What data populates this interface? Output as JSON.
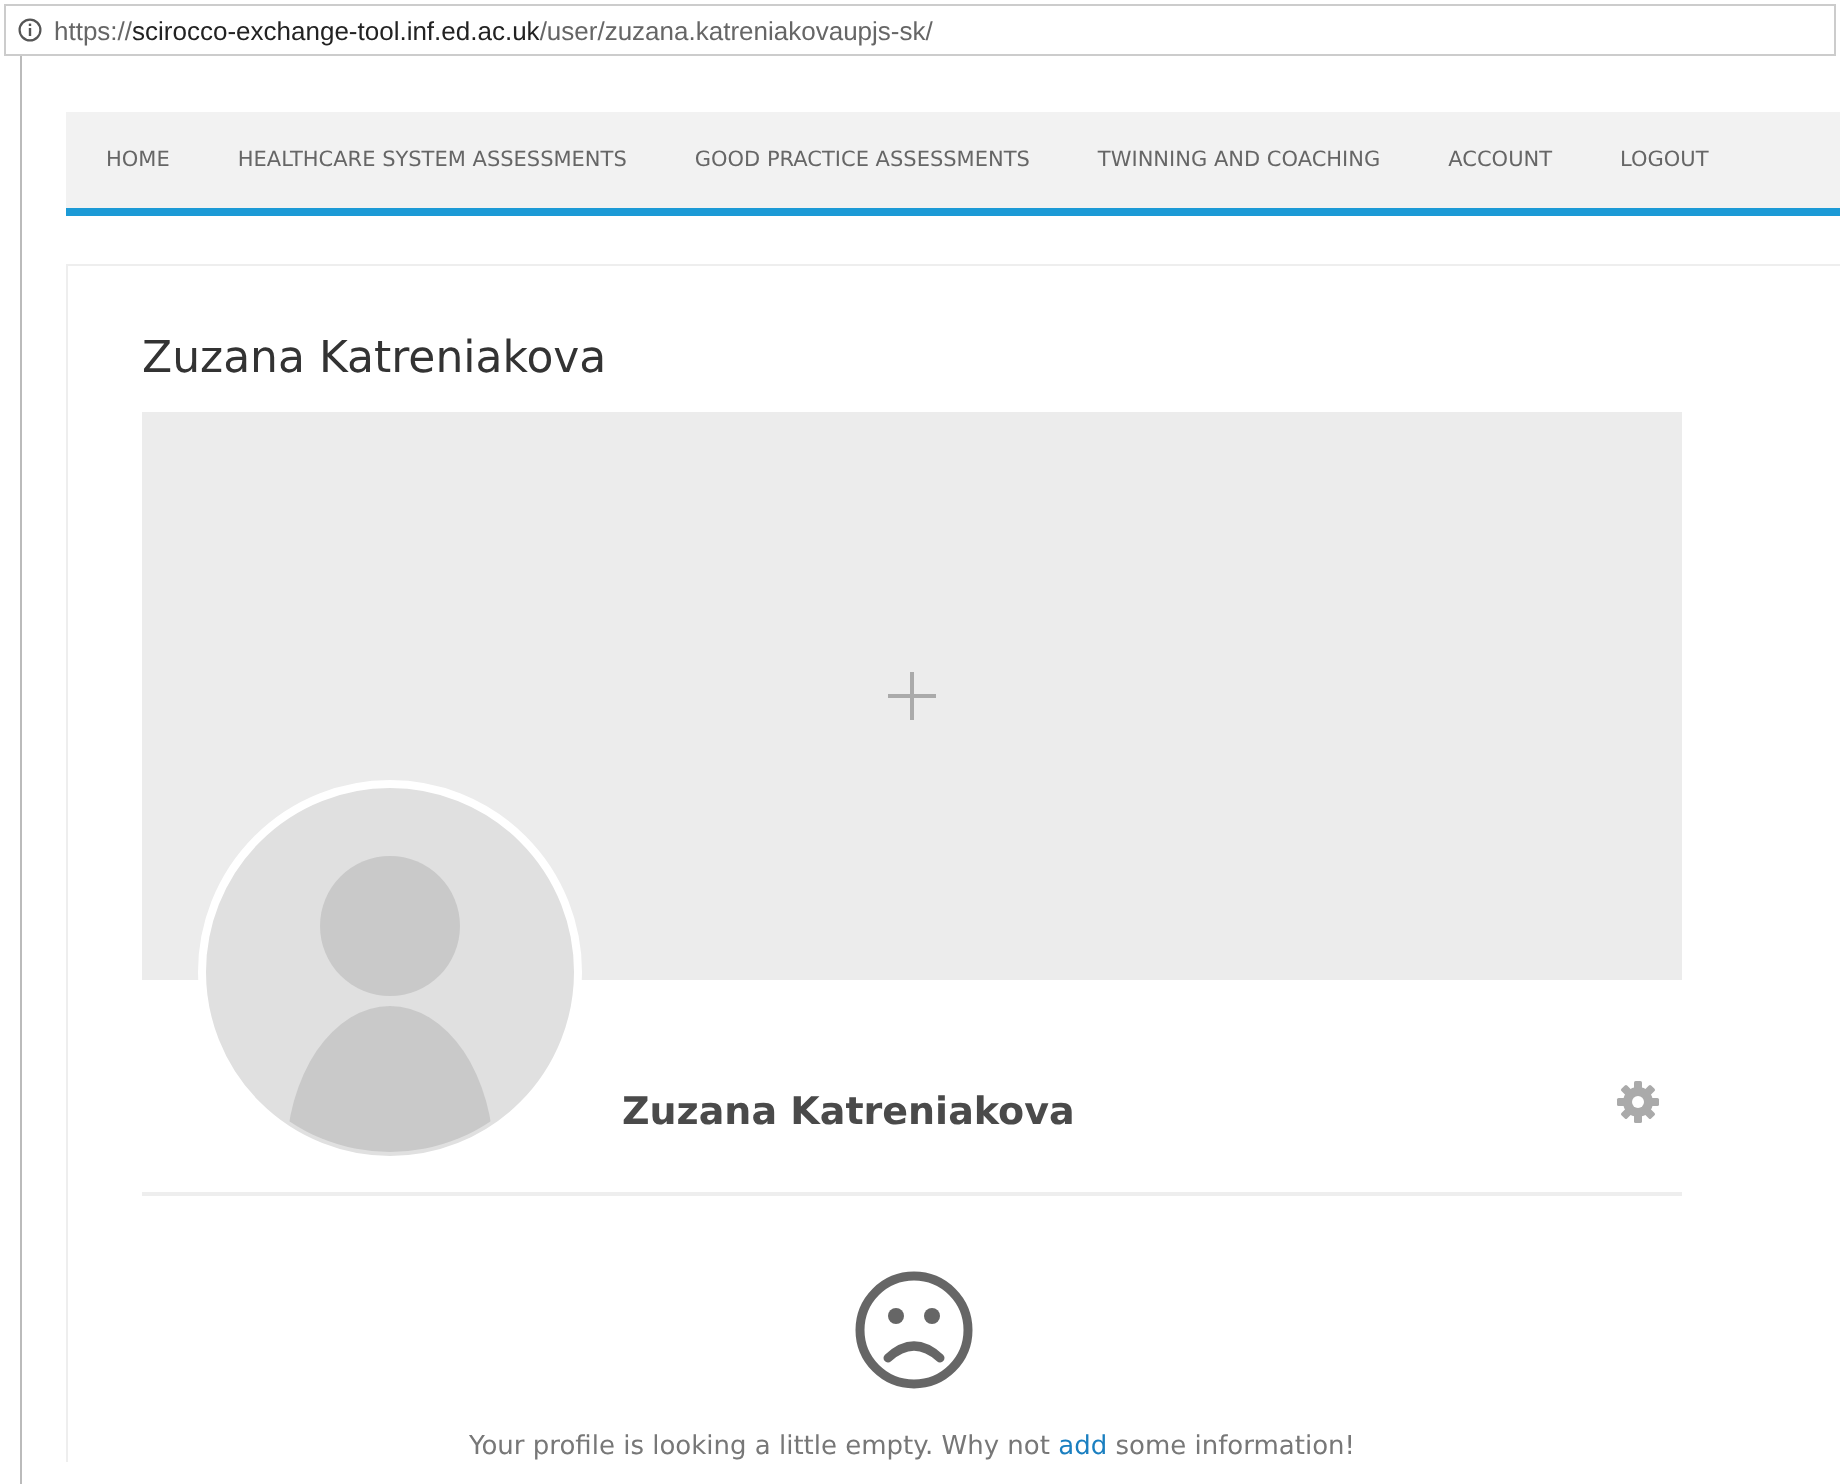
{
  "address_bar": {
    "scheme": "https://",
    "host": "scirocco-exchange-tool.inf.ed.ac.uk",
    "path": "/user/zuzana.katreniakovaupjs-sk/"
  },
  "nav": [
    {
      "label": "HOME"
    },
    {
      "label": "HEALTHCARE SYSTEM ASSESSMENTS"
    },
    {
      "label": "GOOD PRACTICE ASSESSMENTS"
    },
    {
      "label": "TWINNING AND COACHING"
    },
    {
      "label": "ACCOUNT"
    },
    {
      "label": "LOGOUT"
    }
  ],
  "page_title": "Zuzana Katreniakova",
  "profile": {
    "name": "Zuzana Katreniakova"
  },
  "empty_message": {
    "before": "Your profile is looking a little empty. Why not ",
    "link": "add",
    "after": " some information!"
  }
}
